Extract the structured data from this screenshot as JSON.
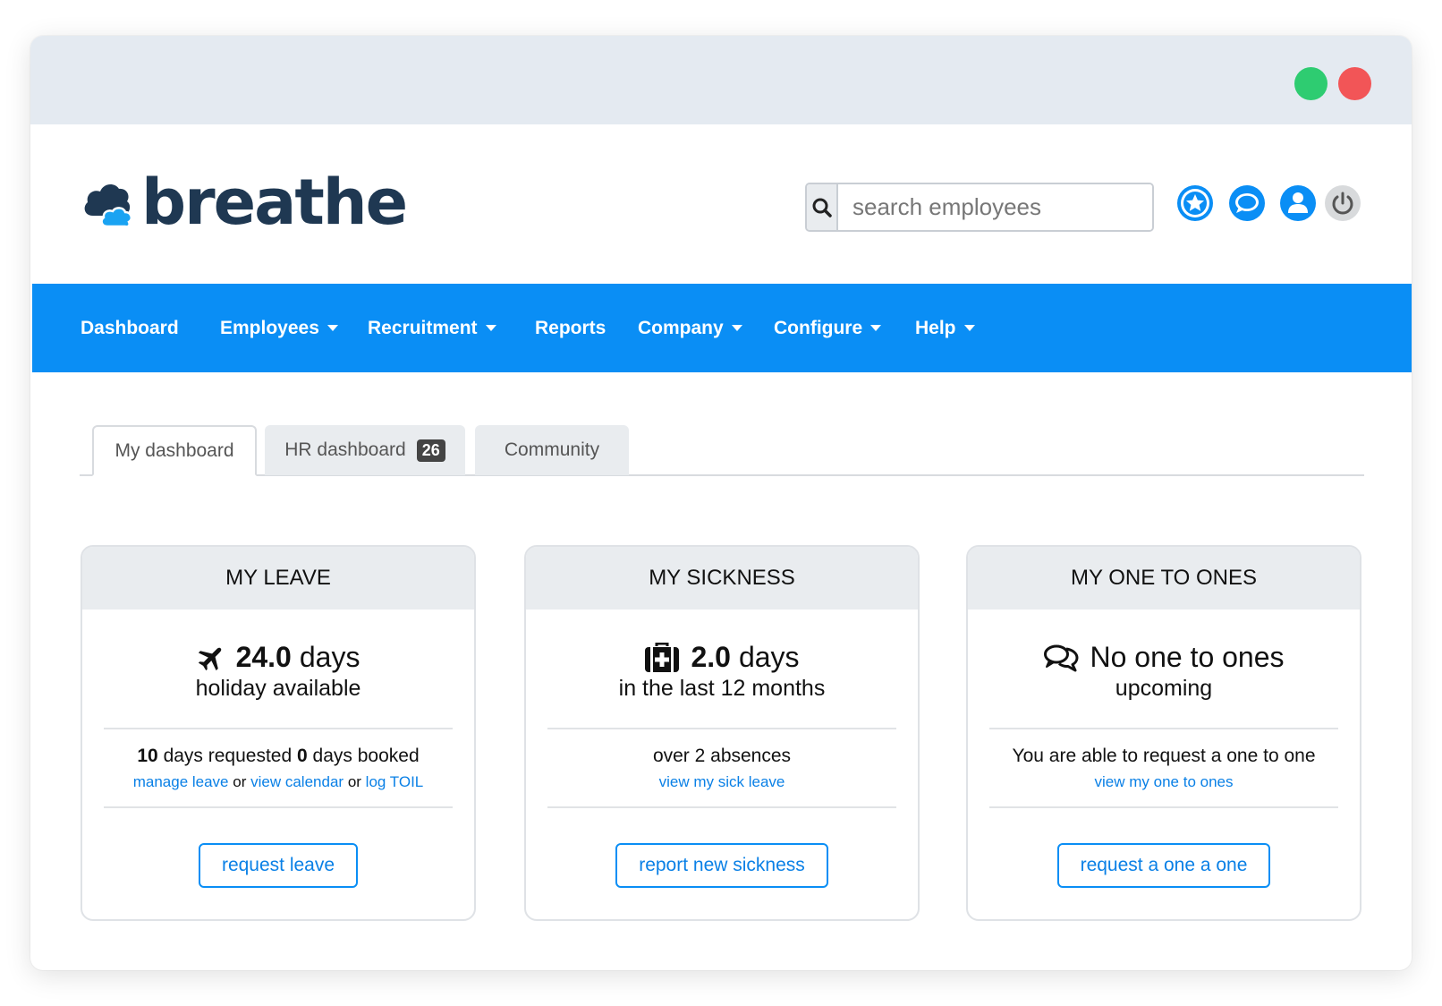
{
  "window": {
    "controls": [
      {
        "name": "maximize",
        "color": "#2ecc71"
      },
      {
        "name": "close",
        "color": "#f25557"
      }
    ]
  },
  "header": {
    "logo_text": "breathe",
    "search": {
      "placeholder": "search employees",
      "value": ""
    },
    "icons": [
      "star-icon",
      "chat-icon",
      "user-icon",
      "power-icon"
    ]
  },
  "colors": {
    "brand_blue": "#0a8ef5",
    "logo_navy": "#1f3852",
    "link_blue": "#0a80e6"
  },
  "nav": {
    "items": [
      {
        "label": "Dashboard",
        "dropdown": false
      },
      {
        "label": "Employees",
        "dropdown": true
      },
      {
        "label": "Recruitment",
        "dropdown": true
      },
      {
        "label": "Reports",
        "dropdown": false
      },
      {
        "label": "Company",
        "dropdown": true
      },
      {
        "label": "Configure",
        "dropdown": true
      },
      {
        "label": "Help",
        "dropdown": true
      }
    ]
  },
  "tabs": [
    {
      "label": "My dashboard",
      "active": true
    },
    {
      "label": "HR dashboard",
      "badge": "26"
    },
    {
      "label": "Community"
    }
  ],
  "cards": {
    "leave": {
      "title": "MY LEAVE",
      "icon": "plane-icon",
      "value": "24.0",
      "unit": "days",
      "subtitle": "holiday available",
      "requested_num": "10",
      "requested_text": "days requested",
      "booked_num": "0",
      "booked_text": "days booked",
      "link_manage": "manage leave",
      "or1": "or",
      "link_calendar": "view calendar",
      "or2": "or",
      "link_toil": "log TOIL",
      "button": "request leave"
    },
    "sickness": {
      "title": "MY SICKNESS",
      "icon": "medkit-icon",
      "value": "2.0",
      "unit": "days",
      "subtitle": "in the last 12 months",
      "detail": "over 2 absences",
      "link": "view my sick leave",
      "button": "report new sickness"
    },
    "one_to_ones": {
      "title": "MY ONE TO ONES",
      "icon": "comments-icon",
      "headline": "No one to ones",
      "subtitle": "upcoming",
      "detail": "You are able to request a one to one",
      "link": "view my one to ones",
      "button": "request a one a one"
    }
  }
}
